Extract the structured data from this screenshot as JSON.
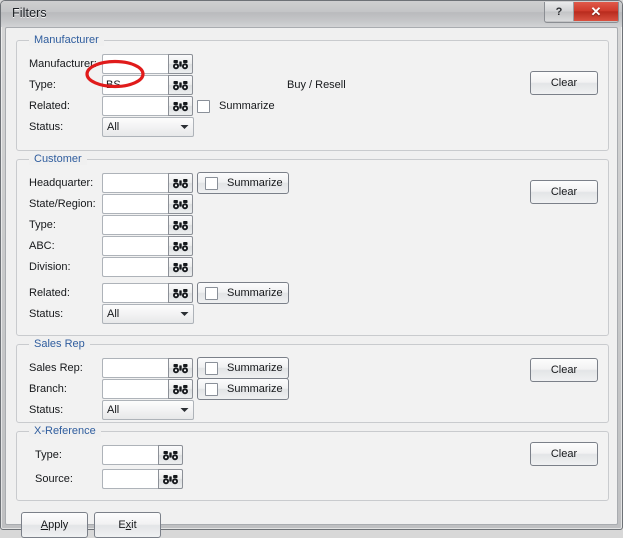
{
  "window": {
    "title": "Filters",
    "help_label": "?",
    "close_label": "✕"
  },
  "groups": {
    "manufacturer": {
      "legend": "Manufacturer",
      "clear_label": "Clear",
      "note": "Buy / Resell",
      "fields": [
        {
          "label": "Manufacturer:",
          "value": "",
          "icon": "binoculars-icon"
        },
        {
          "label": "Type:",
          "value": "BS",
          "icon": "binoculars-icon"
        },
        {
          "label": "Related:",
          "value": "",
          "icon": "binoculars-icon"
        }
      ],
      "summarize_label": "Summarize",
      "summarize_checked": false,
      "status_label": "Status:",
      "status_value": "All"
    },
    "customer": {
      "legend": "Customer",
      "clear_label": "Clear",
      "fields": [
        {
          "label": "Headquarter:",
          "value": "",
          "icon": "binoculars-icon"
        },
        {
          "label": "State/Region:",
          "value": "",
          "icon": "binoculars-icon"
        },
        {
          "label": "Type:",
          "value": "",
          "icon": "binoculars-icon"
        },
        {
          "label": "ABC:",
          "value": "",
          "icon": "binoculars-icon"
        },
        {
          "label": "Division:",
          "value": "",
          "icon": "binoculars-icon"
        },
        {
          "label": "Related:",
          "value": "",
          "icon": "binoculars-icon"
        }
      ],
      "summarize_headquarter_label": "Summarize",
      "summarize_related_label": "Summarize",
      "status_label": "Status:",
      "status_value": "All"
    },
    "salesrep": {
      "legend": "Sales Rep",
      "clear_label": "Clear",
      "fields": [
        {
          "label": "Sales Rep:",
          "value": "",
          "icon": "binoculars-icon"
        },
        {
          "label": "Branch:",
          "value": "",
          "icon": "binoculars-icon"
        }
      ],
      "summarize_salesrep_label": "Summarize",
      "summarize_branch_label": "Summarize",
      "status_label": "Status:",
      "status_value": "All"
    },
    "xreference": {
      "legend": "X-Reference",
      "clear_label": "Clear",
      "fields": [
        {
          "label": "Type:",
          "value": "",
          "icon": "binoculars-icon"
        },
        {
          "label": "Source:",
          "value": "",
          "icon": "binoculars-icon"
        }
      ]
    }
  },
  "footer": {
    "apply_label": "Apply",
    "apply_accel": "A",
    "exit_label": "Exit",
    "exit_accel": "x"
  },
  "annotation": {
    "shape": "ellipse",
    "color": "#e01b1b",
    "target_text": "BS"
  },
  "colors": {
    "legend_blue": "#2f5d9e",
    "annotation_red": "#e01b1b",
    "close_red": "#cf3b2c"
  }
}
